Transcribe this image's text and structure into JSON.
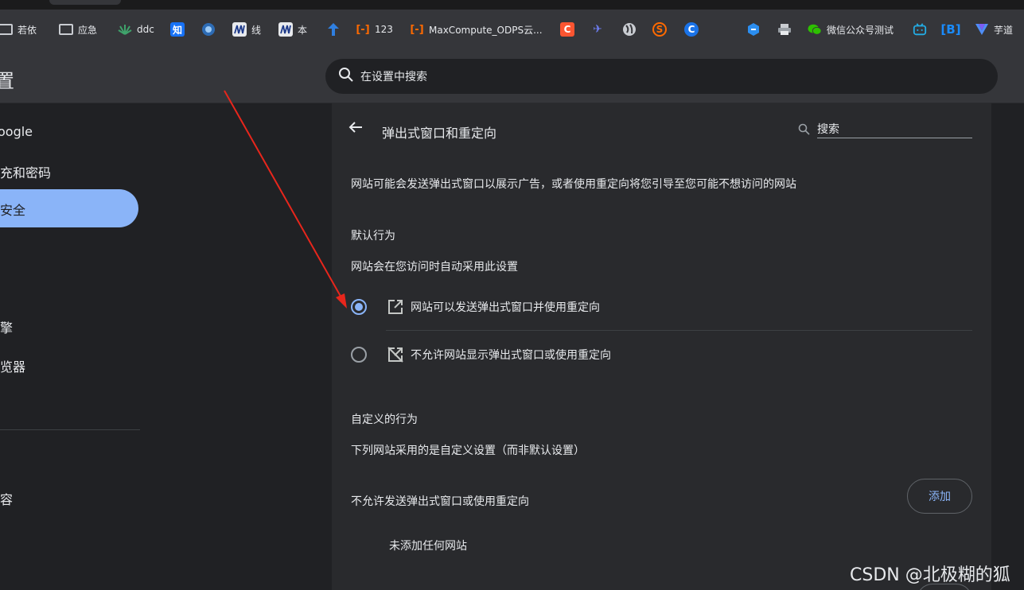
{
  "bookmarks": [
    {
      "label": "若依",
      "icon": "folder-icon"
    },
    {
      "label": "应急",
      "icon": "folder-icon"
    },
    {
      "label": "ddc",
      "icon": "plant-icon"
    },
    {
      "label": "知",
      "icon": "zhihu-icon"
    },
    {
      "label": "",
      "icon": "shield-logo-icon"
    },
    {
      "label": "线",
      "icon": "m-logo-icon"
    },
    {
      "label": "本",
      "icon": "m-logo-icon"
    },
    {
      "label": "",
      "icon": "arrow-logo-icon"
    },
    {
      "label": "123",
      "icon": "aliyun-icon"
    },
    {
      "label": "MaxCompute_ODPS云...",
      "icon": "aliyun-icon"
    },
    {
      "label": "",
      "icon": "c-red-icon"
    },
    {
      "label": "",
      "icon": "bird-icon"
    },
    {
      "label": "",
      "icon": "globe-icon"
    },
    {
      "label": "",
      "icon": "s-orange-icon"
    },
    {
      "label": "",
      "icon": "c-blue-icon"
    },
    {
      "label": "",
      "icon": "cube-icon"
    },
    {
      "label": "",
      "icon": "printer-icon"
    },
    {
      "label": "微信公众号测试",
      "icon": "wechat-icon"
    },
    {
      "label": "",
      "icon": "bilibili-icon"
    },
    {
      "label": "",
      "icon": "b-bracket-icon"
    },
    {
      "label": "芋道",
      "icon": "v-logo-icon"
    }
  ],
  "header": {
    "title": "置",
    "search_placeholder": "在设置中搜索"
  },
  "sidebar": {
    "items": [
      "oogle",
      "充和密码",
      "安全",
      "擎",
      "览器",
      "容"
    ]
  },
  "page": {
    "title": "弹出式窗口和重定向",
    "search_placeholder": "搜索",
    "description": "网站可能会发送弹出式窗口以展示广告，或者使用重定向将您引导至您可能不想访问的网站",
    "default_heading": "默认行为",
    "default_sub": "网站会在您访问时自动采用此设置",
    "options": [
      {
        "label": "网站可以发送弹出式窗口并使用重定向",
        "selected": true
      },
      {
        "label": "不允许网站显示弹出式窗口或使用重定向",
        "selected": false
      }
    ],
    "custom_heading": "自定义的行为",
    "custom_sub": "下列网站采用的是自定义设置（而非默认设置）",
    "block_label": "不允许发送弹出式窗口或使用重定向",
    "add_label": "添加",
    "empty_label": "未添加任何网站"
  },
  "watermark": "CSDN @北极糊的狐",
  "colors": {
    "accent": "#8ab4f8",
    "background": "#202124",
    "card": "#292a2d",
    "toolbar": "#35363a",
    "arrow": "#e8261c"
  }
}
